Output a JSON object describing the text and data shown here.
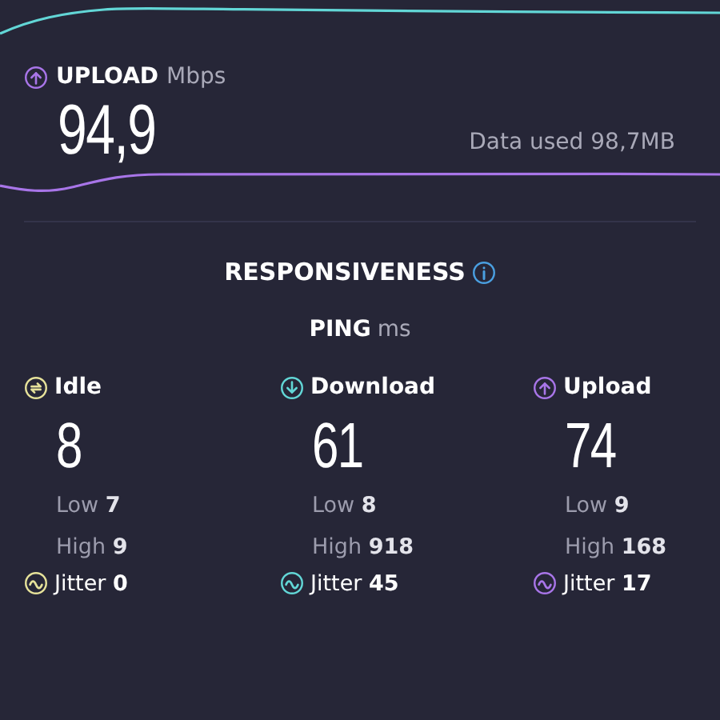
{
  "upload": {
    "label": "UPLOAD",
    "unit": "Mbps",
    "value": "94,9",
    "data_used": "Data used 98,7MB"
  },
  "responsiveness": {
    "title": "RESPONSIVENESS",
    "ping_label": "PING",
    "ping_unit": "ms"
  },
  "ping": [
    {
      "kind": "idle",
      "label": "Idle",
      "color": "#e6e29a",
      "value": "8",
      "low": "Low **7**",
      "high": "High **9**",
      "jitter": "Jitter **0**"
    },
    {
      "kind": "download",
      "label": "Download",
      "color": "#62d6d6",
      "value": "61",
      "low": "Low **8**",
      "high": "High **918**",
      "jitter": "Jitter **45**"
    },
    {
      "kind": "upload",
      "label": "Upload",
      "color": "#a875e8",
      "value": "74",
      "low": "Low **9**",
      "high": "High **168**",
      "jitter": "Jitter **17**"
    }
  ]
}
